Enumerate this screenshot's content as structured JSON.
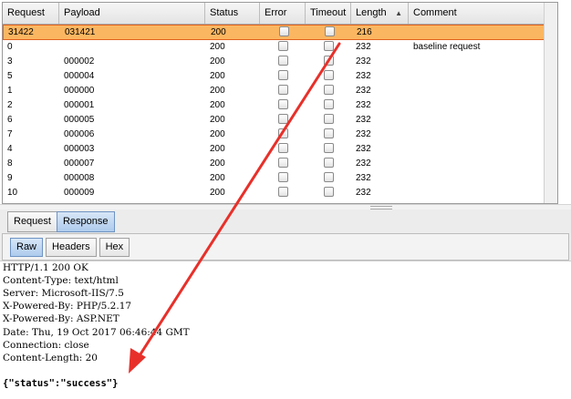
{
  "table": {
    "columns": [
      "Request",
      "Payload",
      "Status",
      "Error",
      "Timeout",
      "Length",
      "Comment"
    ],
    "sort_indicator": "▲",
    "rows": [
      {
        "request": "31422",
        "payload": "031421",
        "status": "200",
        "length": "216",
        "comment": ""
      },
      {
        "request": "0",
        "payload": "",
        "status": "200",
        "length": "232",
        "comment": "baseline request"
      },
      {
        "request": "3",
        "payload": "000002",
        "status": "200",
        "length": "232",
        "comment": ""
      },
      {
        "request": "5",
        "payload": "000004",
        "status": "200",
        "length": "232",
        "comment": ""
      },
      {
        "request": "1",
        "payload": "000000",
        "status": "200",
        "length": "232",
        "comment": ""
      },
      {
        "request": "2",
        "payload": "000001",
        "status": "200",
        "length": "232",
        "comment": ""
      },
      {
        "request": "6",
        "payload": "000005",
        "status": "200",
        "length": "232",
        "comment": ""
      },
      {
        "request": "7",
        "payload": "000006",
        "status": "200",
        "length": "232",
        "comment": ""
      },
      {
        "request": "4",
        "payload": "000003",
        "status": "200",
        "length": "232",
        "comment": ""
      },
      {
        "request": "8",
        "payload": "000007",
        "status": "200",
        "length": "232",
        "comment": ""
      },
      {
        "request": "9",
        "payload": "000008",
        "status": "200",
        "length": "232",
        "comment": ""
      },
      {
        "request": "10",
        "payload": "000009",
        "status": "200",
        "length": "232",
        "comment": ""
      }
    ]
  },
  "tabs": {
    "request": "Request",
    "response": "Response"
  },
  "subtabs": {
    "raw": "Raw",
    "headers": "Headers",
    "hex": "Hex"
  },
  "response": {
    "lines": [
      "HTTP/1.1 200 OK",
      "Content-Type: text/html",
      "Server: Microsoft-IIS/7.5",
      "X-Powered-By: PHP/5.2.17",
      "X-Powered-By: ASP.NET",
      "Date: Thu, 19 Oct 2017 06:46:44 GMT",
      "Connection: close",
      "Content-Length: 20"
    ],
    "body": "{\"status\":\"success\"}"
  },
  "colors": {
    "selected_row": "#fbb661",
    "highlight_box": "#e0621f",
    "annotation_arrow": "#e8302a"
  }
}
